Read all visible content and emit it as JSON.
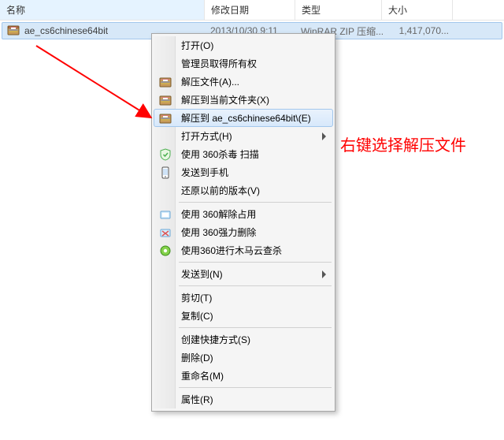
{
  "columns": {
    "name": "名称",
    "date": "修改日期",
    "type": "类型",
    "size": "大小"
  },
  "file": {
    "name": "ae_cs6chinese64bit",
    "date": "2013/10/30 9:11",
    "type": "WinRAR ZIP 压缩...",
    "size": "1,417,070..."
  },
  "menu": {
    "open": "打开(O)",
    "admin": "管理员取得所有权",
    "extract_files": "解压文件(A)...",
    "extract_here": "解压到当前文件夹(X)",
    "extract_to_named": "解压到 ae_cs6chinese64bit\\(E)",
    "open_with": "打开方式(H)",
    "scan_360": "使用 360杀毒 扫描",
    "send_to_phone": "发送到手机",
    "prev_versions": "还原以前的版本(V)",
    "unlock_360": "使用 360解除占用",
    "force_del_360": "使用 360强力删除",
    "trojan_scan_360": "使用360进行木马云查杀",
    "send_to": "发送到(N)",
    "cut": "剪切(T)",
    "copy": "复制(C)",
    "shortcut": "创建快捷方式(S)",
    "delete": "删除(D)",
    "rename": "重命名(M)",
    "properties": "属性(R)"
  },
  "annotation": "右键选择解压文件",
  "colors": {
    "highlight_bg": "#d7e8fb",
    "highlight_border": "#a3c7ec",
    "annotation": "#ff0000"
  }
}
